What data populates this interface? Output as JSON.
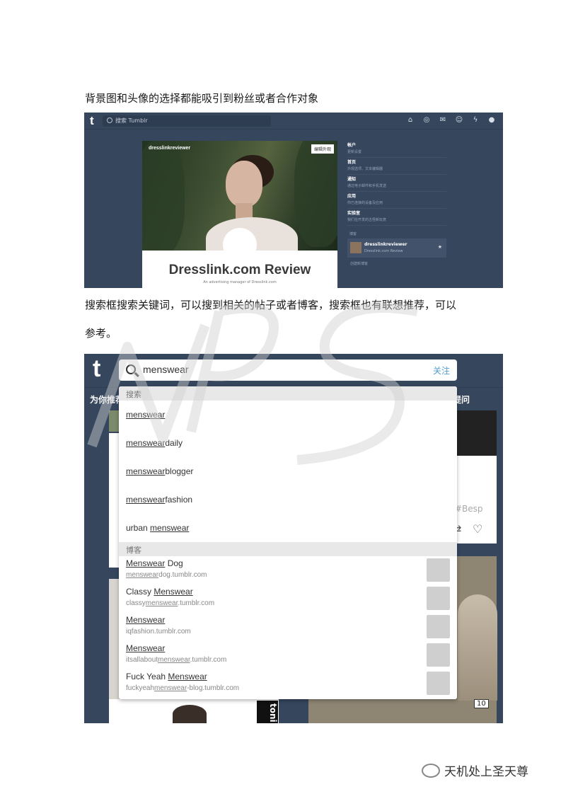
{
  "captions": {
    "first": "背景图和头像的选择都能吸引到粉丝或者合作对象",
    "second_line1": "搜索框搜索关键词，可以搜到相关的帖子或者博客，搜索框也有联想推荐，可以",
    "second_line2": "参考。"
  },
  "shot1": {
    "logo": "t",
    "search_placeholder": "搜索 Tumblr",
    "cover_blogname": "dresslinkreviewer",
    "edit_button": "编辑外观",
    "blog_title": "Dresslink.com Review",
    "blog_subtitle": "An advertising manager of Dresslink.com",
    "menu": [
      {
        "title": "帐户",
        "sub": "更新设置"
      },
      {
        "title": "首页",
        "sub": "外观选项、文本编辑器"
      },
      {
        "title": "通知",
        "sub": "通过电子邮件和手机发送"
      },
      {
        "title": "应用",
        "sub": "你已连接的设备及应用"
      },
      {
        "title": "实验室",
        "sub": "我们在开发的古怪新玩意"
      }
    ],
    "blogs_label": "博客",
    "blog_card": {
      "name": "dresslinkreviewer",
      "url": "Dresslink.com Review"
    },
    "create_blog": "创建新博客"
  },
  "shot2": {
    "logo": "t",
    "search_value": "menswear",
    "follow_label": "关注",
    "tab_recommended": "为你推荐",
    "tab_ask": "提问",
    "post_tag": "#Besp",
    "badge": "10",
    "toni_text": "toni",
    "section_search": "搜索",
    "suggestions": [
      {
        "match": "menswear",
        "rest": "",
        "prefix": ""
      },
      {
        "match": "menswear",
        "rest": "daily",
        "prefix": ""
      },
      {
        "match": "menswear",
        "rest": "blogger",
        "prefix": ""
      },
      {
        "match": "menswear",
        "rest": "fashion",
        "prefix": ""
      },
      {
        "match": "menswear",
        "rest": "",
        "prefix": "urban "
      }
    ],
    "section_blogs": "博客",
    "blogs": [
      {
        "name_pre": "",
        "name_match": "Menswear",
        "name_post": " Dog",
        "url_pre": "",
        "url_match": "menswear",
        "url_post": "dog.tumblr.com"
      },
      {
        "name_pre": "Classy ",
        "name_match": "Menswear",
        "name_post": "",
        "url_pre": "classy",
        "url_match": "menswear",
        "url_post": ".tumblr.com"
      },
      {
        "name_pre": "",
        "name_match": "Menswear",
        "name_post": "",
        "url_pre": "iqfashion.tumblr.com",
        "url_match": "",
        "url_post": ""
      },
      {
        "name_pre": "",
        "name_match": "Menswear",
        "name_post": "",
        "url_pre": "itsallabout",
        "url_match": "menswear",
        "url_post": ".tumblr.com"
      },
      {
        "name_pre": "Fuck Yeah ",
        "name_match": "Menswear",
        "name_post": "",
        "url_pre": "fuckyeah",
        "url_match": "menswear",
        "url_post": "-blog.tumblr.com"
      }
    ]
  },
  "footer": {
    "account_name": "天机处上圣天尊"
  }
}
